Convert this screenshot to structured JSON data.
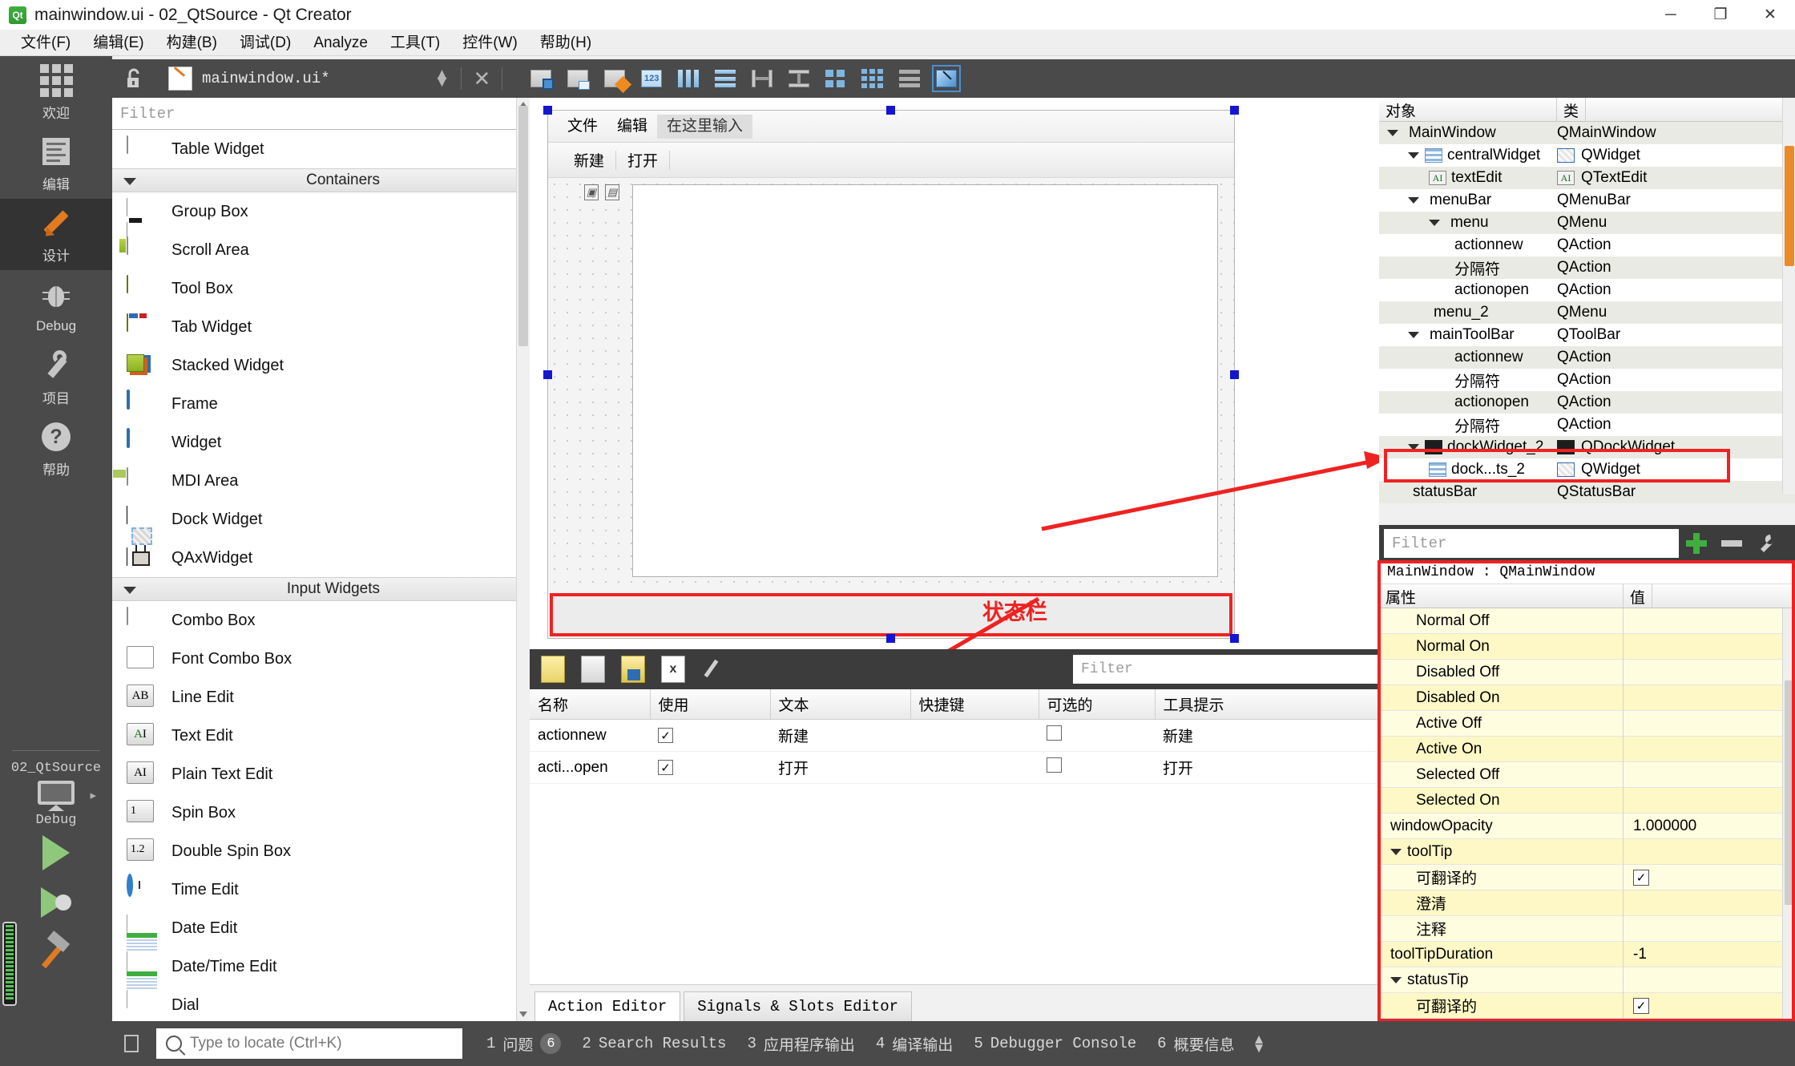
{
  "window": {
    "title": "mainwindow.ui - 02_QtSource - Qt Creator",
    "app_badge": "Qt",
    "minimize": "─",
    "maximize": "❐",
    "close": "✕"
  },
  "menubar": [
    {
      "label": "文件(F)"
    },
    {
      "label": "编辑(E)"
    },
    {
      "label": "构建(B)"
    },
    {
      "label": "调试(D)"
    },
    {
      "label": "Analyze"
    },
    {
      "label": "工具(T)"
    },
    {
      "label": "控件(W)"
    },
    {
      "label": "帮助(H)"
    }
  ],
  "modebar": [
    {
      "label": "欢迎",
      "icon": "grid-icon",
      "active": false
    },
    {
      "label": "编辑",
      "icon": "document-icon",
      "active": false
    },
    {
      "label": "设计",
      "icon": "pencil-icon",
      "active": true
    },
    {
      "label": "Debug",
      "icon": "bug-icon",
      "active": false
    },
    {
      "label": "项目",
      "icon": "wrench-icon",
      "active": false
    },
    {
      "label": "帮助",
      "icon": "help-icon",
      "active": false
    }
  ],
  "kit_selector": {
    "project": "02_QtSource",
    "build_config": "Debug",
    "target_icon": "monitor-icon",
    "run_icon": "play-icon",
    "debug_icon": "play-debug-icon",
    "build_icon": "hammer-icon"
  },
  "designer_toolbar": {
    "file_name": "mainwindow.ui*",
    "lock_icon": "unlock-icon",
    "updown_icon": "updown-arrows-icon",
    "close_icon": "close-x-icon",
    "buttons": [
      {
        "name": "edit-widgets-button",
        "icon": "edit-widgets-icon"
      },
      {
        "name": "edit-signals-slots-button",
        "icon": "signals-slots-icon"
      },
      {
        "name": "edit-buddies-button",
        "icon": "buddies-icon"
      },
      {
        "name": "edit-tab-order-button",
        "icon": "tab-order-icon"
      },
      {
        "name": "layout-horizontally-button",
        "icon": "layout-horizontal-icon"
      },
      {
        "name": "layout-vertically-button",
        "icon": "layout-vertical-icon"
      },
      {
        "name": "layout-splitter-horizontal-button",
        "icon": "splitter-h-icon"
      },
      {
        "name": "layout-splitter-vertical-button",
        "icon": "splitter-v-icon"
      },
      {
        "name": "layout-grid-button",
        "icon": "layout-grid-icon"
      },
      {
        "name": "layout-form-button",
        "icon": "layout-form-icon"
      },
      {
        "name": "break-layout-button",
        "icon": "break-layout-icon"
      },
      {
        "name": "adjust-size-button",
        "icon": "adjust-size-icon"
      }
    ]
  },
  "widget_box": {
    "filter_placeholder": "Filter",
    "items": [
      {
        "type": "item",
        "label": "Table Widget",
        "icon": "table-widget-icon"
      },
      {
        "type": "category",
        "label": "Containers"
      },
      {
        "type": "item",
        "label": "Group Box",
        "icon": "group-box-icon"
      },
      {
        "type": "item",
        "label": "Scroll Area",
        "icon": "scroll-area-icon"
      },
      {
        "type": "item",
        "label": "Tool Box",
        "icon": "tool-box-icon"
      },
      {
        "type": "item",
        "label": "Tab Widget",
        "icon": "tab-widget-icon"
      },
      {
        "type": "item",
        "label": "Stacked Widget",
        "icon": "stacked-widget-icon"
      },
      {
        "type": "item",
        "label": "Frame",
        "icon": "frame-icon"
      },
      {
        "type": "item",
        "label": "Widget",
        "icon": "widget-icon"
      },
      {
        "type": "item",
        "label": "MDI Area",
        "icon": "mdi-area-icon"
      },
      {
        "type": "item",
        "label": "Dock Widget",
        "icon": "dock-widget-icon"
      },
      {
        "type": "item",
        "label": "QAxWidget",
        "icon": "qax-widget-icon"
      },
      {
        "type": "category",
        "label": "Input Widgets"
      },
      {
        "type": "item",
        "label": "Combo Box",
        "icon": "combo-box-icon"
      },
      {
        "type": "item",
        "label": "Font Combo Box",
        "icon": "font-combo-box-icon"
      },
      {
        "type": "item",
        "label": "Line Edit",
        "icon": "line-edit-icon"
      },
      {
        "type": "item",
        "label": "Text Edit",
        "icon": "text-edit-icon"
      },
      {
        "type": "item",
        "label": "Plain Text Edit",
        "icon": "plain-text-edit-icon"
      },
      {
        "type": "item",
        "label": "Spin Box",
        "icon": "spin-box-icon"
      },
      {
        "type": "item",
        "label": "Double Spin Box",
        "icon": "double-spin-box-icon"
      },
      {
        "type": "item",
        "label": "Time Edit",
        "icon": "time-edit-icon"
      },
      {
        "type": "item",
        "label": "Date Edit",
        "icon": "date-edit-icon"
      },
      {
        "type": "item",
        "label": "Date/Time Edit",
        "icon": "date-time-edit-icon"
      },
      {
        "type": "item",
        "label": "Dial",
        "icon": "dial-icon"
      }
    ]
  },
  "form_preview": {
    "menu_items": [
      "文件",
      "编辑"
    ],
    "menu_placeholder": "在这里输入",
    "toolbar_items": [
      "新建",
      "打开"
    ],
    "annotation": "状态栏"
  },
  "action_editor": {
    "filter_placeholder": "Filter",
    "toolbar_icons": [
      "new-action-icon",
      "copy-action-icon",
      "edit-action-icon",
      "delete-action-icon",
      "configure-icon"
    ],
    "columns": [
      "名称",
      "使用",
      "文本",
      "快捷键",
      "可选的",
      "工具提示"
    ],
    "rows": [
      {
        "name": "actionnew",
        "used": "✓",
        "text": "新建",
        "shortcut": "",
        "checkable": "",
        "tooltip": "新建"
      },
      {
        "name": "acti...open",
        "used": "✓",
        "text": "打开",
        "shortcut": "",
        "checkable": "",
        "tooltip": "打开"
      }
    ],
    "tabs": [
      {
        "label": "Action Editor",
        "active": true
      },
      {
        "label": "Signals & Slots Editor",
        "active": false
      }
    ]
  },
  "object_inspector": {
    "columns": [
      "对象",
      "类"
    ],
    "rows": [
      {
        "object": "MainWindow",
        "class": "QMainWindow",
        "indent": 0,
        "expander": true,
        "icon": ""
      },
      {
        "object": "centralWidget",
        "class": "QWidget",
        "indent": 1,
        "expander": true,
        "icon": "layout-icon"
      },
      {
        "object": "textEdit",
        "class": "QTextEdit",
        "indent": 2,
        "expander": false,
        "icon": "qtextedit-icon"
      },
      {
        "object": "menuBar",
        "class": "QMenuBar",
        "indent": 1,
        "expander": true,
        "icon": ""
      },
      {
        "object": "menu",
        "class": "QMenu",
        "indent": 2,
        "expander": true,
        "icon": ""
      },
      {
        "object": "actionnew",
        "class": "QAction",
        "indent": 3,
        "expander": false,
        "icon": ""
      },
      {
        "object": "分隔符",
        "class": "QAction",
        "indent": 3,
        "expander": false,
        "icon": ""
      },
      {
        "object": "actionopen",
        "class": "QAction",
        "indent": 3,
        "expander": false,
        "icon": ""
      },
      {
        "object": "menu_2",
        "class": "QMenu",
        "indent": 2,
        "expander": false,
        "icon": ""
      },
      {
        "object": "mainToolBar",
        "class": "QToolBar",
        "indent": 1,
        "expander": true,
        "icon": ""
      },
      {
        "object": "actionnew",
        "class": "QAction",
        "indent": 3,
        "expander": false,
        "icon": ""
      },
      {
        "object": "分隔符",
        "class": "QAction",
        "indent": 3,
        "expander": false,
        "icon": ""
      },
      {
        "object": "actionopen",
        "class": "QAction",
        "indent": 3,
        "expander": false,
        "icon": ""
      },
      {
        "object": "分隔符",
        "class": "QAction",
        "indent": 3,
        "expander": false,
        "icon": ""
      },
      {
        "object": "dockWidget_2",
        "class": "QDockWidget",
        "indent": 1,
        "expander": true,
        "icon": "dockwidget-icon"
      },
      {
        "object": "dock...ts_2",
        "class": "QWidget",
        "indent": 2,
        "expander": false,
        "icon": "layout-icon"
      },
      {
        "object": "statusBar",
        "class": "QStatusBar",
        "indent": 1,
        "expander": false,
        "icon": "",
        "highlighted": true
      }
    ]
  },
  "property_editor": {
    "filter_placeholder": "Filter",
    "add_button": "add-property-icon",
    "remove_button": "remove-property-icon",
    "configure_button": "configure-property-icon",
    "selected_object": "MainWindow : QMainWindow",
    "columns": [
      "属性",
      "值"
    ],
    "rows": [
      {
        "key": "Normal Off",
        "value": "",
        "indent": 1,
        "expander": false,
        "shade": "a"
      },
      {
        "key": "Normal On",
        "value": "",
        "indent": 1,
        "expander": false,
        "shade": "b"
      },
      {
        "key": "Disabled Off",
        "value": "",
        "indent": 1,
        "expander": false,
        "shade": "a"
      },
      {
        "key": "Disabled On",
        "value": "",
        "indent": 1,
        "expander": false,
        "shade": "b"
      },
      {
        "key": "Active Off",
        "value": "",
        "indent": 1,
        "expander": false,
        "shade": "a"
      },
      {
        "key": "Active On",
        "value": "",
        "indent": 1,
        "expander": false,
        "shade": "b"
      },
      {
        "key": "Selected Off",
        "value": "",
        "indent": 1,
        "expander": false,
        "shade": "a"
      },
      {
        "key": "Selected On",
        "value": "",
        "indent": 1,
        "expander": false,
        "shade": "b"
      },
      {
        "key": "windowOpacity",
        "value": "1.000000",
        "indent": 0,
        "expander": false,
        "shade": "a"
      },
      {
        "key": "toolTip",
        "value": "",
        "indent": 0,
        "expander": true,
        "shade": "b"
      },
      {
        "key": "可翻译的",
        "value": "✓",
        "indent": 1,
        "expander": false,
        "shade": "a",
        "checkbox": true
      },
      {
        "key": "澄清",
        "value": "",
        "indent": 1,
        "expander": false,
        "shade": "b"
      },
      {
        "key": "注释",
        "value": "",
        "indent": 1,
        "expander": false,
        "shade": "a"
      },
      {
        "key": "toolTipDuration",
        "value": "-1",
        "indent": 0,
        "expander": false,
        "shade": "b"
      },
      {
        "key": "statusTip",
        "value": "",
        "indent": 0,
        "expander": true,
        "shade": "a"
      },
      {
        "key": "可翻译的",
        "value": "✓",
        "indent": 1,
        "expander": false,
        "shade": "b",
        "checkbox": true
      }
    ]
  },
  "bottom_bar": {
    "locate_placeholder": "Type to locate (Ctrl+K)",
    "items": [
      {
        "num": "1",
        "label": "问题",
        "badge": "6"
      },
      {
        "num": "2",
        "label": "Search Results",
        "badge": ""
      },
      {
        "num": "3",
        "label": "应用程序输出",
        "badge": ""
      },
      {
        "num": "4",
        "label": "编译输出",
        "badge": ""
      },
      {
        "num": "5",
        "label": "Debugger Console",
        "badge": ""
      },
      {
        "num": "6",
        "label": "概要信息",
        "badge": ""
      }
    ]
  },
  "colors": {
    "accent_red": "#ef2222",
    "mode_active_bg": "#333333",
    "toolbar_dark": "#4a4a4a",
    "property_yellow": "#fffde0",
    "selection_blue": "#1515d0"
  }
}
